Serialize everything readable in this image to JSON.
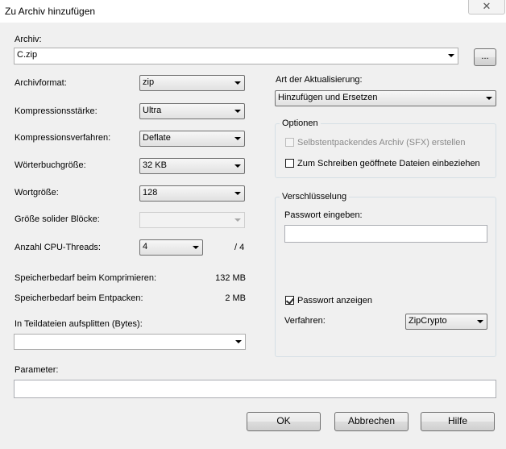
{
  "window": {
    "title": "Zu Archiv hinzufügen",
    "close_icon": "✕"
  },
  "archive": {
    "label": "Archiv:",
    "value": "C.zip",
    "browse_label": "..."
  },
  "left": {
    "format": {
      "label": "Archivformat:",
      "value": "zip"
    },
    "level": {
      "label": "Kompressionsstärke:",
      "value": "Ultra"
    },
    "method": {
      "label": "Kompressionsverfahren:",
      "value": "Deflate"
    },
    "dictionary": {
      "label": "Wörterbuchgröße:",
      "value": "32 KB"
    },
    "word": {
      "label": "Wortgröße:",
      "value": "128"
    },
    "solid": {
      "label": "Größe solider Blöcke:",
      "value": ""
    },
    "threads": {
      "label": "Anzahl CPU-Threads:",
      "value": "4",
      "total": "/ 4"
    },
    "mem_compress": {
      "label": "Speicherbedarf beim Komprimieren:",
      "value": "132 MB"
    },
    "mem_decompress": {
      "label": "Speicherbedarf beim Entpacken:",
      "value": "2 MB"
    },
    "split": {
      "label": "In Teildateien aufsplitten (Bytes):",
      "value": ""
    }
  },
  "right": {
    "update": {
      "label": "Art der Aktualisierung:",
      "value": "Hinzufügen und Ersetzen"
    },
    "options": {
      "title": "Optionen",
      "sfx": {
        "label": "Selbstentpackendes Archiv (SFX) erstellen",
        "checked": false,
        "enabled": false
      },
      "shared": {
        "label": "Zum Schreiben geöffnete Dateien einbeziehen",
        "checked": false,
        "enabled": true
      }
    },
    "encryption": {
      "title": "Verschlüsselung",
      "password_label": "Passwort eingeben:",
      "password_value": "",
      "show_password": {
        "label": "Passwort anzeigen",
        "checked": true
      },
      "method_label": "Verfahren:",
      "method_value": "ZipCrypto"
    }
  },
  "parameters": {
    "label": "Parameter:",
    "value": ""
  },
  "buttons": {
    "ok": "OK",
    "cancel": "Abbrechen",
    "help": "Hilfe"
  }
}
